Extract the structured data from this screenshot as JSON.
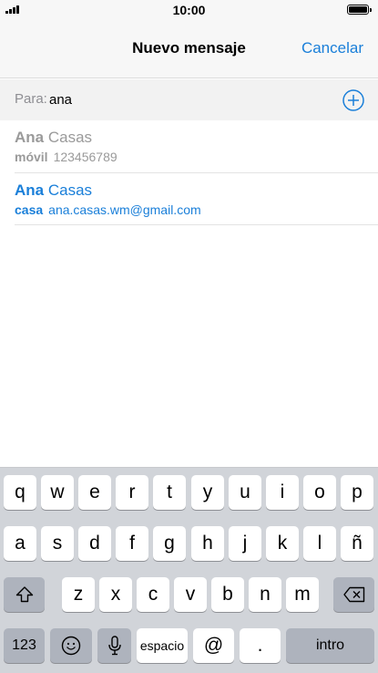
{
  "status_bar": {
    "time": "10:00"
  },
  "nav": {
    "title": "Nuevo mensaje",
    "cancel_label": "Cancelar"
  },
  "to_field": {
    "label": "Para:",
    "value": "ana"
  },
  "suggestions": [
    {
      "first": "Ana",
      "last": "Casas",
      "type": "móvil",
      "value": "123456789"
    },
    {
      "first": "Ana",
      "last": "Casas",
      "type": "casa",
      "value": "ana.casas.wm@gmail.com"
    }
  ],
  "keyboard": {
    "row1": [
      "q",
      "w",
      "e",
      "r",
      "t",
      "y",
      "u",
      "i",
      "o",
      "p"
    ],
    "row2": [
      "a",
      "s",
      "d",
      "f",
      "g",
      "h",
      "j",
      "k",
      "l",
      "ñ"
    ],
    "row3": [
      "z",
      "x",
      "c",
      "v",
      "b",
      "n",
      "m"
    ],
    "numbers_label": "123",
    "space_label": "espacio",
    "at_label": "@",
    "dot_label": ".",
    "return_label": "intro"
  },
  "colors": {
    "accent": "#1a7fd9",
    "keyboard_bg": "#d1d4d9",
    "dark_key": "#aeb3bd"
  },
  "icons": {
    "signal": "signal-bars-icon",
    "battery": "battery-icon",
    "add_contact": "plus-circle-icon",
    "shift": "shift-arrow-icon",
    "backspace": "backspace-icon",
    "emoji": "emoji-icon",
    "microphone": "microphone-icon"
  }
}
